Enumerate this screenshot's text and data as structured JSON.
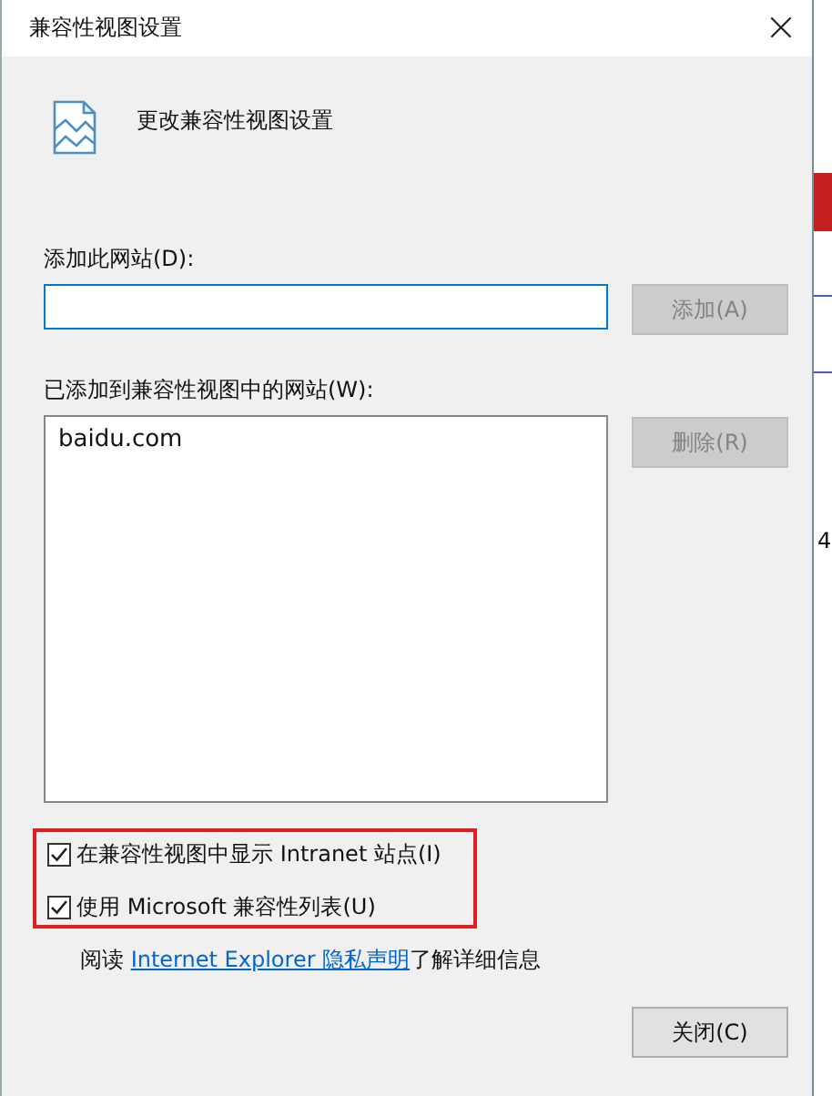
{
  "window": {
    "title": "兼容性视图设置",
    "close": "×"
  },
  "heading": "更改兼容性视图设置",
  "add_site": {
    "label": "添加此网站(D):",
    "button": {
      "label": "添加(A)",
      "disabled": true
    }
  },
  "site_list": {
    "label": "已添加到兼容性视图中的网站(W):",
    "items": [
      {
        "text": "baidu.com",
        "selected": false
      }
    ],
    "button": {
      "label": "删除(R)",
      "disabled": true
    }
  },
  "options": [
    {
      "label": "在兼容性视图中显示 Intranet 站点(I)",
      "checked": true
    },
    {
      "label": "使用 Microsoft 兼容性列表(U)",
      "checked": true
    }
  ],
  "privacy": {
    "prefix": "阅读 ",
    "link": "Internet Explorer 隐私声明",
    "suffix": "了解详细信息"
  },
  "close_button": "关闭(C)",
  "background_window": {
    "text": "4"
  }
}
